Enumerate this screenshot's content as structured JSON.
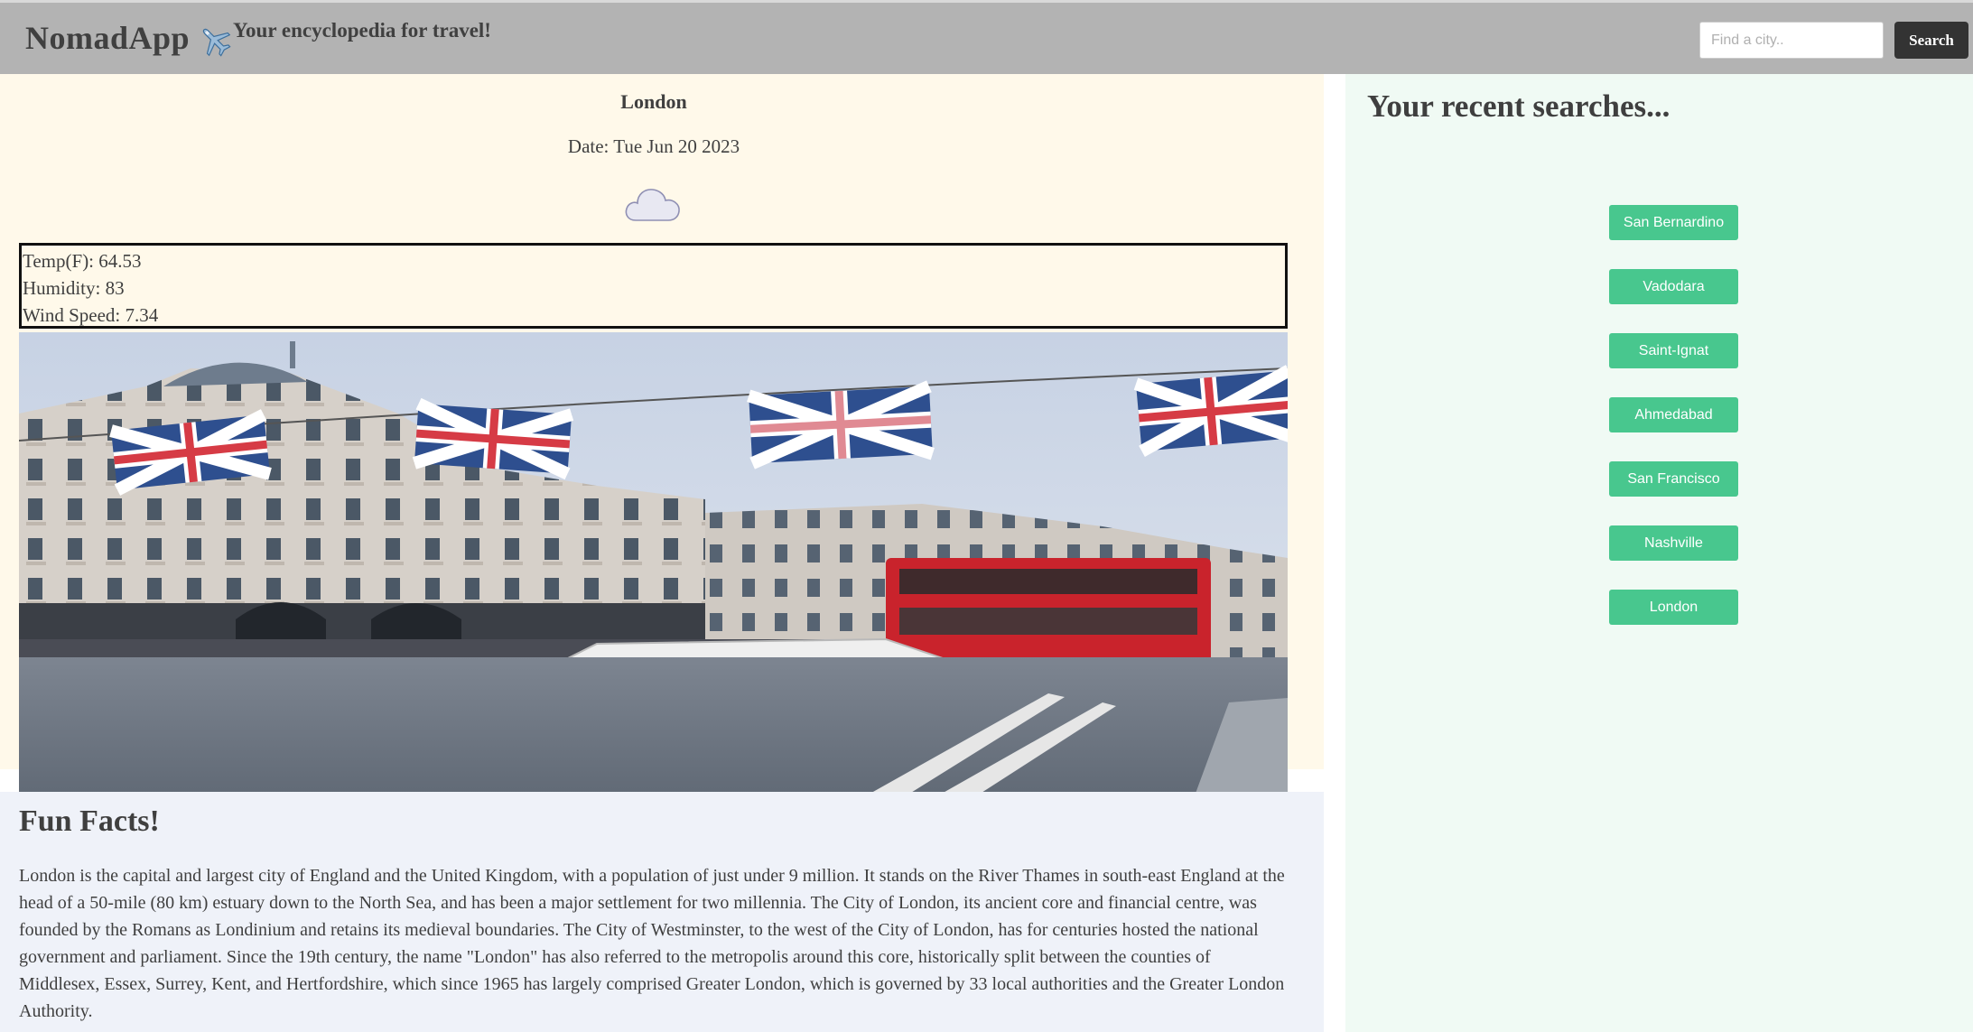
{
  "header": {
    "brand": "NomadApp",
    "plane_icon": "airplane-icon",
    "tagline": "Your encyclopedia for travel!",
    "search_placeholder": "Find a city..",
    "search_value": "",
    "search_button": "Search",
    "background": "#b3b3b3"
  },
  "weather": {
    "city": "London",
    "date": "Date: Tue Jun 20 2023",
    "icon": "cloud-icon",
    "temp": "Temp(F): 64.53",
    "humidity": "Humidity: 83",
    "wind": "Wind Speed: 7.34",
    "photo": "london-street-photo",
    "background": "#fff9ea"
  },
  "facts": {
    "title": "Fun Facts!",
    "text": "London is the capital and largest city of England and the United Kingdom, with a population of just under 9 million. It stands on the River Thames in south-east England at the head of a 50-mile (80 km) estuary down to the North Sea, and has been a major settlement for two millennia. The City of London, its ancient core and financial centre, was founded by the Romans as Londinium and retains its medieval boundaries. The City of Westminster, to the west of the City of London, has for centuries hosted the national government and parliament. Since the 19th century, the name \"London\" has also referred to the metropolis around this core, historically split between the counties of Middlesex, Essex, Surrey, Kent, and Hertfordshire, which since 1965 has largely comprised Greater London, which is governed by 33 local authorities and the Greater London Authority.",
    "background": "#eff2f9"
  },
  "sidebar": {
    "title": "Your recent searches...",
    "background": "#f0faf4",
    "accent": "#48c78e",
    "items": [
      "San Bernardino",
      "Vadodara",
      "Saint-Ignat",
      "Ahmedabad",
      "San Francisco",
      "Nashville",
      "London"
    ]
  }
}
